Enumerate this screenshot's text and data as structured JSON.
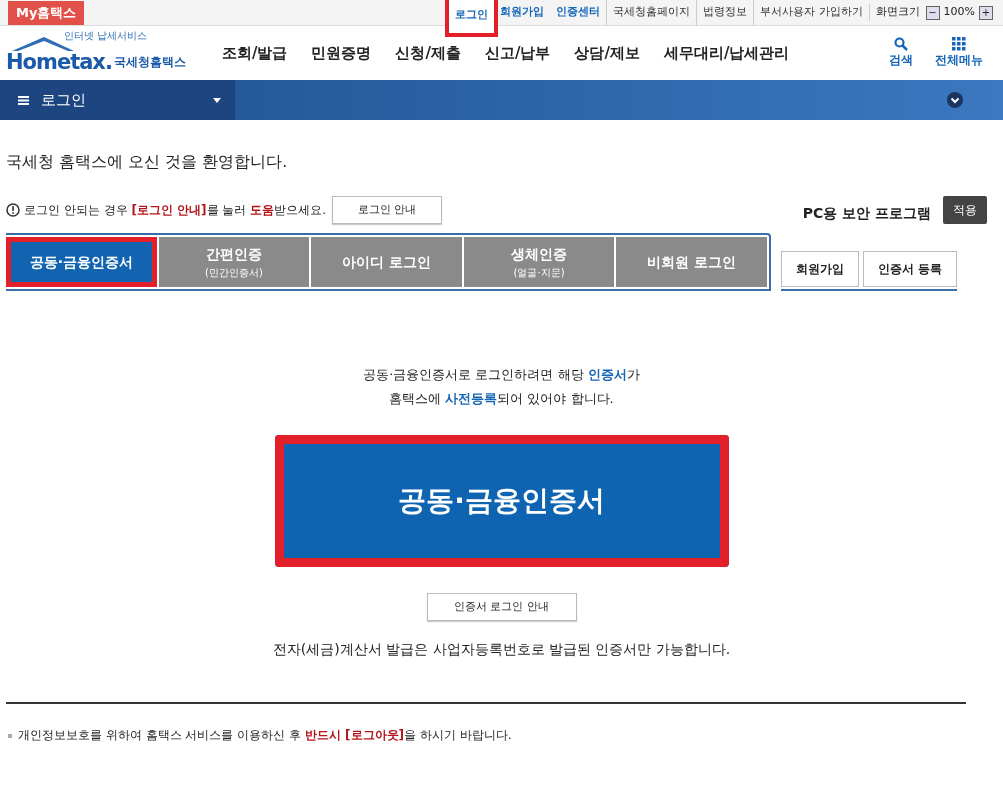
{
  "top_bar": {
    "my_button": "My홈택스",
    "links": [
      {
        "label": "로그인",
        "highlighted": true
      },
      {
        "label": "회원가입",
        "highlighted": false
      },
      {
        "label": "인증센터",
        "highlighted": false
      },
      {
        "label": "국세청홈페이지",
        "highlighted": false
      },
      {
        "label": "법령정보",
        "highlighted": false
      },
      {
        "label": "부서사용자 가입하기",
        "highlighted": false
      }
    ],
    "zoom_label": "화면크기",
    "zoom_minus": "−",
    "zoom_value": "100%",
    "zoom_plus": "+"
  },
  "header": {
    "logo_small": "인터넷 납세서비스",
    "logo_main": "Hometax.",
    "logo_sub": "국세청홈택스",
    "menu": [
      "조회/발급",
      "민원증명",
      "신청/제출",
      "신고/납부",
      "상담/제보",
      "세무대리/납세관리"
    ],
    "search": "검색",
    "all_menu": "전체메뉴"
  },
  "breadcrumb": {
    "title": "로그인"
  },
  "welcome": "국세청 홈택스에 오신 것을 환영합니다.",
  "help": {
    "segments": [
      {
        "text": "로그인 안되는 경우 ",
        "emphasis": false
      },
      {
        "text": "[로그인 안내]",
        "emphasis": true
      },
      {
        "text": "를 눌러 ",
        "emphasis": false
      },
      {
        "text": "도움",
        "emphasis": true
      },
      {
        "text": "받으세요.",
        "emphasis": false
      }
    ],
    "button": "로그인 안내"
  },
  "security": {
    "label": "PC용 보안 프로그램",
    "button": "적용"
  },
  "tabs": [
    {
      "label": "공동·금융인증서",
      "selected": true,
      "highlighted": true
    },
    {
      "label": "간편인증",
      "sub": "(민간인증서)",
      "selected": false,
      "highlighted": false
    },
    {
      "label": "아이디 로그인",
      "selected": false,
      "highlighted": false
    },
    {
      "label": "생체인증",
      "sub": "(얼굴·지문)",
      "selected": false,
      "highlighted": false
    },
    {
      "label": "비회원 로그인",
      "selected": false,
      "highlighted": false
    }
  ],
  "side_buttons": [
    "회원가입",
    "인증서 등록"
  ],
  "notice": [
    [
      {
        "text": "공동·금융인증서로 로그인하려면 해당 ",
        "emphasis": false
      },
      {
        "text": "인증서",
        "emphasis": true
      },
      {
        "text": "가",
        "emphasis": false
      }
    ],
    [
      {
        "text": "홈택스에 ",
        "emphasis": false
      },
      {
        "text": "사전등록",
        "emphasis": true
      },
      {
        "text": "되어 있어야 합니다.",
        "emphasis": false
      }
    ]
  ],
  "main_button": {
    "label": "공동·금융인증서",
    "highlighted": true
  },
  "guide_button": "인증서 로그인 안내",
  "invoice_note": "전자(세금)계산서 발급은 사업자등록번호로 발급된 인증서만 가능합니다.",
  "footer": [
    {
      "text": "개인정보보호를 위하여 홈택스 서비스를 이용하신 후 ",
      "emphasis": false
    },
    {
      "text": "반드시 [로그아웃]",
      "emphasis": true
    },
    {
      "text": "을 하시기 바랍니다.",
      "emphasis": false
    }
  ]
}
